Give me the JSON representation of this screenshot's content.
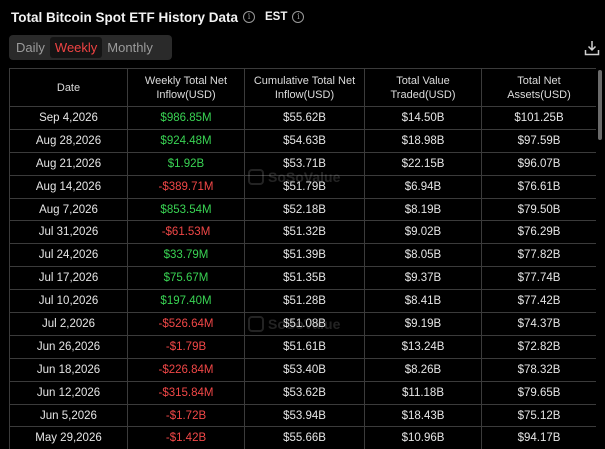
{
  "header": {
    "title": "Total Bitcoin Spot ETF History Data",
    "timezone": "EST",
    "info_glyph": "i"
  },
  "period_tabs": [
    {
      "label": "Daily",
      "active": false
    },
    {
      "label": "Weekly",
      "active": true
    },
    {
      "label": "Monthly",
      "active": false
    }
  ],
  "columns": [
    "Date",
    "Weekly Total Net Inflow(USD)",
    "Cumulative Total Net Inflow(USD)",
    "Total Value Traded(USD)",
    "Total Net Assets(USD)"
  ],
  "rows": [
    {
      "date": "Sep 4,2026",
      "inflow": "$986.85M",
      "dir": "pos",
      "cumulative": "$55.62B",
      "traded": "$14.50B",
      "assets": "$101.25B"
    },
    {
      "date": "Aug 28,2026",
      "inflow": "$924.48M",
      "dir": "pos",
      "cumulative": "$54.63B",
      "traded": "$18.98B",
      "assets": "$97.59B"
    },
    {
      "date": "Aug 21,2026",
      "inflow": "$1.92B",
      "dir": "pos",
      "cumulative": "$53.71B",
      "traded": "$22.15B",
      "assets": "$96.07B"
    },
    {
      "date": "Aug 14,2026",
      "inflow": "-$389.71M",
      "dir": "neg",
      "cumulative": "$51.79B",
      "traded": "$6.94B",
      "assets": "$76.61B"
    },
    {
      "date": "Aug 7,2026",
      "inflow": "$853.54M",
      "dir": "pos",
      "cumulative": "$52.18B",
      "traded": "$8.19B",
      "assets": "$79.50B"
    },
    {
      "date": "Jul 31,2026",
      "inflow": "-$61.53M",
      "dir": "neg",
      "cumulative": "$51.32B",
      "traded": "$9.02B",
      "assets": "$76.29B"
    },
    {
      "date": "Jul 24,2026",
      "inflow": "$33.79M",
      "dir": "pos",
      "cumulative": "$51.39B",
      "traded": "$8.05B",
      "assets": "$77.82B"
    },
    {
      "date": "Jul 17,2026",
      "inflow": "$75.67M",
      "dir": "pos",
      "cumulative": "$51.35B",
      "traded": "$9.37B",
      "assets": "$77.74B"
    },
    {
      "date": "Jul 10,2026",
      "inflow": "$197.40M",
      "dir": "pos",
      "cumulative": "$51.28B",
      "traded": "$8.41B",
      "assets": "$77.42B"
    },
    {
      "date": "Jul 2,2026",
      "inflow": "-$526.64M",
      "dir": "neg",
      "cumulative": "$51.08B",
      "traded": "$9.19B",
      "assets": "$74.37B"
    },
    {
      "date": "Jun 26,2026",
      "inflow": "-$1.79B",
      "dir": "neg",
      "cumulative": "$51.61B",
      "traded": "$13.24B",
      "assets": "$72.82B"
    },
    {
      "date": "Jun 18,2026",
      "inflow": "-$226.84M",
      "dir": "neg",
      "cumulative": "$53.40B",
      "traded": "$8.26B",
      "assets": "$78.32B"
    },
    {
      "date": "Jun 12,2026",
      "inflow": "-$315.84M",
      "dir": "neg",
      "cumulative": "$53.62B",
      "traded": "$11.18B",
      "assets": "$79.65B"
    },
    {
      "date": "Jun 5,2026",
      "inflow": "-$1.72B",
      "dir": "neg",
      "cumulative": "$53.94B",
      "traded": "$18.43B",
      "assets": "$75.12B"
    },
    {
      "date": "May 29,2026",
      "inflow": "-$1.42B",
      "dir": "neg",
      "cumulative": "$55.66B",
      "traded": "$10.96B",
      "assets": "$94.17B"
    }
  ],
  "watermark": {
    "text": "SoSoValue"
  },
  "colors": {
    "positive": "#39d353",
    "negative": "#f04747",
    "active_tab": "#ef4343",
    "background": "#000000"
  },
  "icons": {
    "download": "download-icon",
    "info": "info-icon"
  }
}
